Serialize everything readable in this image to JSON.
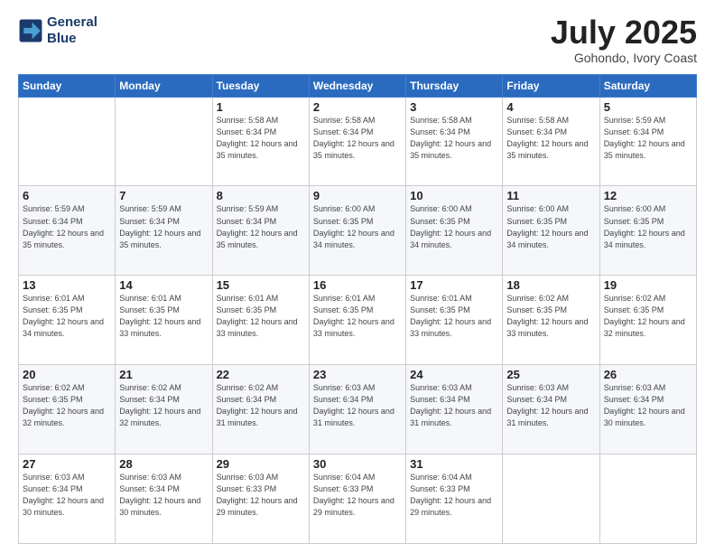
{
  "header": {
    "logo_line1": "General",
    "logo_line2": "Blue",
    "month": "July 2025",
    "location": "Gohondo, Ivory Coast"
  },
  "weekdays": [
    "Sunday",
    "Monday",
    "Tuesday",
    "Wednesday",
    "Thursday",
    "Friday",
    "Saturday"
  ],
  "weeks": [
    [
      {
        "day": "",
        "sunrise": "",
        "sunset": "",
        "daylight": ""
      },
      {
        "day": "",
        "sunrise": "",
        "sunset": "",
        "daylight": ""
      },
      {
        "day": "1",
        "sunrise": "Sunrise: 5:58 AM",
        "sunset": "Sunset: 6:34 PM",
        "daylight": "Daylight: 12 hours and 35 minutes."
      },
      {
        "day": "2",
        "sunrise": "Sunrise: 5:58 AM",
        "sunset": "Sunset: 6:34 PM",
        "daylight": "Daylight: 12 hours and 35 minutes."
      },
      {
        "day": "3",
        "sunrise": "Sunrise: 5:58 AM",
        "sunset": "Sunset: 6:34 PM",
        "daylight": "Daylight: 12 hours and 35 minutes."
      },
      {
        "day": "4",
        "sunrise": "Sunrise: 5:58 AM",
        "sunset": "Sunset: 6:34 PM",
        "daylight": "Daylight: 12 hours and 35 minutes."
      },
      {
        "day": "5",
        "sunrise": "Sunrise: 5:59 AM",
        "sunset": "Sunset: 6:34 PM",
        "daylight": "Daylight: 12 hours and 35 minutes."
      }
    ],
    [
      {
        "day": "6",
        "sunrise": "Sunrise: 5:59 AM",
        "sunset": "Sunset: 6:34 PM",
        "daylight": "Daylight: 12 hours and 35 minutes."
      },
      {
        "day": "7",
        "sunrise": "Sunrise: 5:59 AM",
        "sunset": "Sunset: 6:34 PM",
        "daylight": "Daylight: 12 hours and 35 minutes."
      },
      {
        "day": "8",
        "sunrise": "Sunrise: 5:59 AM",
        "sunset": "Sunset: 6:34 PM",
        "daylight": "Daylight: 12 hours and 35 minutes."
      },
      {
        "day": "9",
        "sunrise": "Sunrise: 6:00 AM",
        "sunset": "Sunset: 6:35 PM",
        "daylight": "Daylight: 12 hours and 34 minutes."
      },
      {
        "day": "10",
        "sunrise": "Sunrise: 6:00 AM",
        "sunset": "Sunset: 6:35 PM",
        "daylight": "Daylight: 12 hours and 34 minutes."
      },
      {
        "day": "11",
        "sunrise": "Sunrise: 6:00 AM",
        "sunset": "Sunset: 6:35 PM",
        "daylight": "Daylight: 12 hours and 34 minutes."
      },
      {
        "day": "12",
        "sunrise": "Sunrise: 6:00 AM",
        "sunset": "Sunset: 6:35 PM",
        "daylight": "Daylight: 12 hours and 34 minutes."
      }
    ],
    [
      {
        "day": "13",
        "sunrise": "Sunrise: 6:01 AM",
        "sunset": "Sunset: 6:35 PM",
        "daylight": "Daylight: 12 hours and 34 minutes."
      },
      {
        "day": "14",
        "sunrise": "Sunrise: 6:01 AM",
        "sunset": "Sunset: 6:35 PM",
        "daylight": "Daylight: 12 hours and 33 minutes."
      },
      {
        "day": "15",
        "sunrise": "Sunrise: 6:01 AM",
        "sunset": "Sunset: 6:35 PM",
        "daylight": "Daylight: 12 hours and 33 minutes."
      },
      {
        "day": "16",
        "sunrise": "Sunrise: 6:01 AM",
        "sunset": "Sunset: 6:35 PM",
        "daylight": "Daylight: 12 hours and 33 minutes."
      },
      {
        "day": "17",
        "sunrise": "Sunrise: 6:01 AM",
        "sunset": "Sunset: 6:35 PM",
        "daylight": "Daylight: 12 hours and 33 minutes."
      },
      {
        "day": "18",
        "sunrise": "Sunrise: 6:02 AM",
        "sunset": "Sunset: 6:35 PM",
        "daylight": "Daylight: 12 hours and 33 minutes."
      },
      {
        "day": "19",
        "sunrise": "Sunrise: 6:02 AM",
        "sunset": "Sunset: 6:35 PM",
        "daylight": "Daylight: 12 hours and 32 minutes."
      }
    ],
    [
      {
        "day": "20",
        "sunrise": "Sunrise: 6:02 AM",
        "sunset": "Sunset: 6:35 PM",
        "daylight": "Daylight: 12 hours and 32 minutes."
      },
      {
        "day": "21",
        "sunrise": "Sunrise: 6:02 AM",
        "sunset": "Sunset: 6:34 PM",
        "daylight": "Daylight: 12 hours and 32 minutes."
      },
      {
        "day": "22",
        "sunrise": "Sunrise: 6:02 AM",
        "sunset": "Sunset: 6:34 PM",
        "daylight": "Daylight: 12 hours and 31 minutes."
      },
      {
        "day": "23",
        "sunrise": "Sunrise: 6:03 AM",
        "sunset": "Sunset: 6:34 PM",
        "daylight": "Daylight: 12 hours and 31 minutes."
      },
      {
        "day": "24",
        "sunrise": "Sunrise: 6:03 AM",
        "sunset": "Sunset: 6:34 PM",
        "daylight": "Daylight: 12 hours and 31 minutes."
      },
      {
        "day": "25",
        "sunrise": "Sunrise: 6:03 AM",
        "sunset": "Sunset: 6:34 PM",
        "daylight": "Daylight: 12 hours and 31 minutes."
      },
      {
        "day": "26",
        "sunrise": "Sunrise: 6:03 AM",
        "sunset": "Sunset: 6:34 PM",
        "daylight": "Daylight: 12 hours and 30 minutes."
      }
    ],
    [
      {
        "day": "27",
        "sunrise": "Sunrise: 6:03 AM",
        "sunset": "Sunset: 6:34 PM",
        "daylight": "Daylight: 12 hours and 30 minutes."
      },
      {
        "day": "28",
        "sunrise": "Sunrise: 6:03 AM",
        "sunset": "Sunset: 6:34 PM",
        "daylight": "Daylight: 12 hours and 30 minutes."
      },
      {
        "day": "29",
        "sunrise": "Sunrise: 6:03 AM",
        "sunset": "Sunset: 6:33 PM",
        "daylight": "Daylight: 12 hours and 29 minutes."
      },
      {
        "day": "30",
        "sunrise": "Sunrise: 6:04 AM",
        "sunset": "Sunset: 6:33 PM",
        "daylight": "Daylight: 12 hours and 29 minutes."
      },
      {
        "day": "31",
        "sunrise": "Sunrise: 6:04 AM",
        "sunset": "Sunset: 6:33 PM",
        "daylight": "Daylight: 12 hours and 29 minutes."
      },
      {
        "day": "",
        "sunrise": "",
        "sunset": "",
        "daylight": ""
      },
      {
        "day": "",
        "sunrise": "",
        "sunset": "",
        "daylight": ""
      }
    ]
  ]
}
